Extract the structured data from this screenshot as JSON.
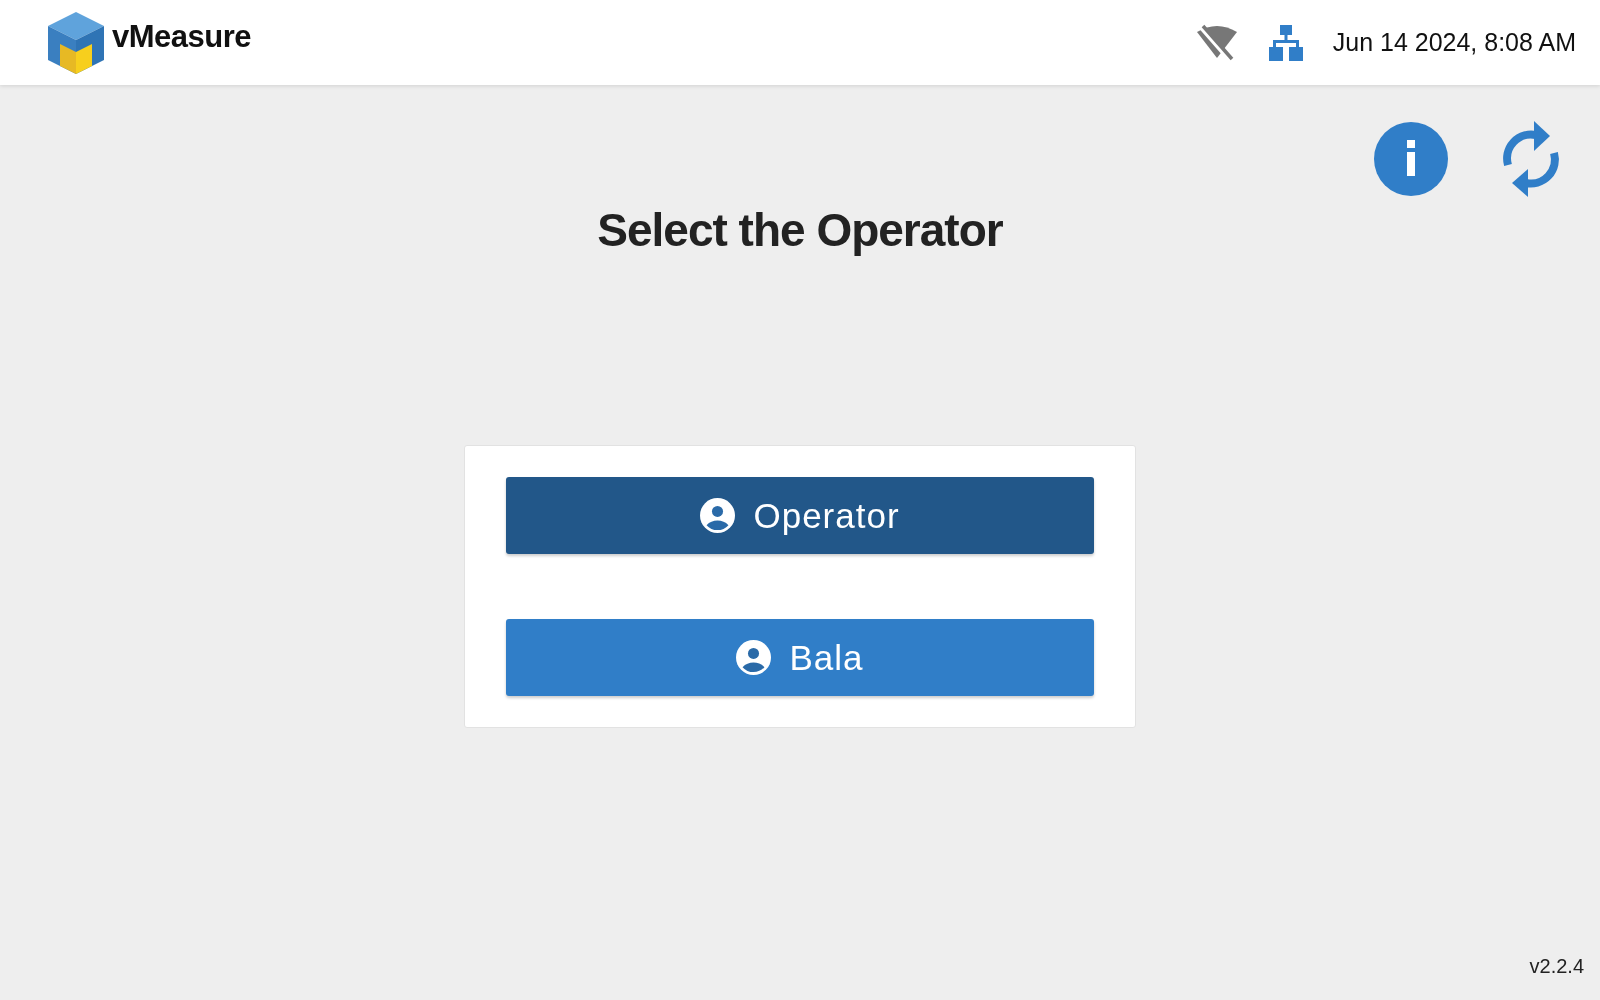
{
  "header": {
    "app_name": "vMeasure",
    "wifi_connected": false,
    "datetime": "Jun 14 2024, 8:08 AM"
  },
  "title": "Select the Operator",
  "operators": [
    {
      "name": "Operator",
      "selected": true
    },
    {
      "name": "Bala",
      "selected": false
    }
  ],
  "version": "v2.2.4"
}
